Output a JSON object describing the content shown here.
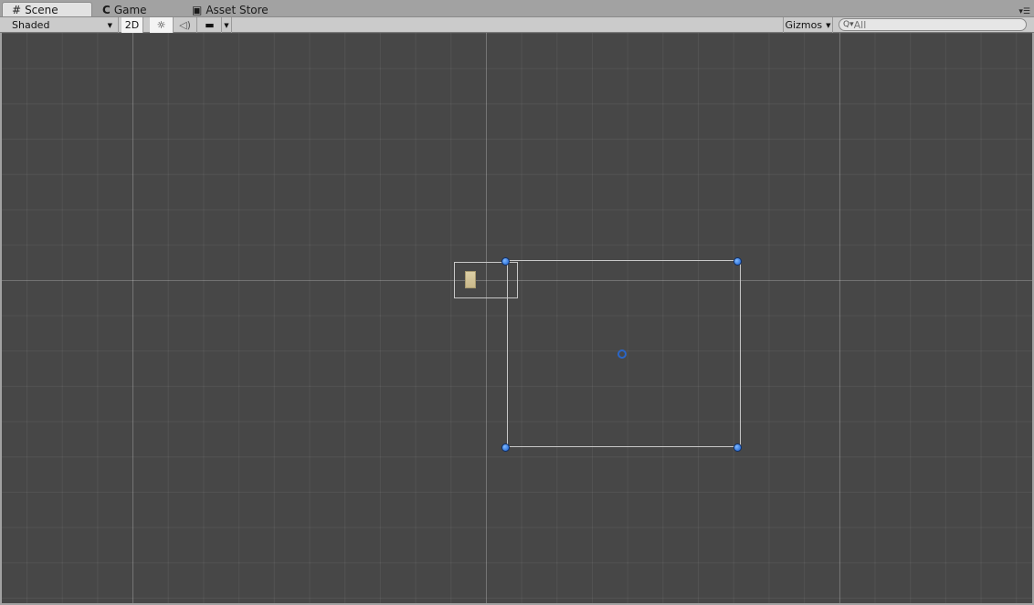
{
  "tabs": [
    {
      "label": "Scene",
      "icon": "grid-icon"
    },
    {
      "label": "Game",
      "icon": "pacman-icon"
    },
    {
      "label": "Asset Store",
      "icon": "store-bag-icon"
    }
  ],
  "toolbar": {
    "draw_mode": "Shaded",
    "mode_2d": "2D",
    "gizmos": "Gizmos",
    "search_placeholder": "All"
  },
  "scene": {
    "selected_object": "camera bounds",
    "handle_color": "#2a78e8",
    "background": "#474747"
  }
}
